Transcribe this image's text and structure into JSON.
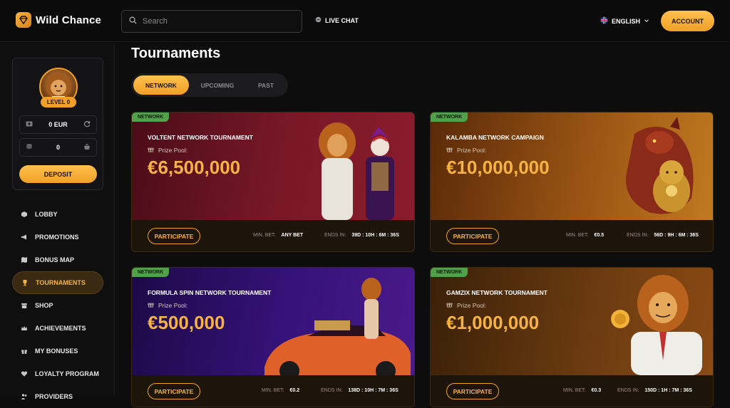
{
  "header": {
    "brand": "Wild Chance",
    "search_placeholder": "Search",
    "live_chat": "LIVE CHAT",
    "language": "ENGLISH",
    "account": "ACCOUNT"
  },
  "profile": {
    "level": "LEVEL 0",
    "balance": "0 EUR",
    "coins": "0",
    "deposit": "DEPOSIT"
  },
  "nav": [
    {
      "label": "LOBBY",
      "icon": "cube-icon"
    },
    {
      "label": "PROMOTIONS",
      "icon": "megaphone-icon"
    },
    {
      "label": "BONUS MAP",
      "icon": "map-icon"
    },
    {
      "label": "TOURNAMENTS",
      "icon": "trophy-icon",
      "active": true
    },
    {
      "label": "SHOP",
      "icon": "shop-icon"
    },
    {
      "label": "ACHIEVEMENTS",
      "icon": "crown-icon"
    },
    {
      "label": "MY BONUSES",
      "icon": "gift-icon"
    },
    {
      "label": "LOYALTY PROGRAM",
      "icon": "heart-icon"
    },
    {
      "label": "PROVIDERS",
      "icon": "people-icon"
    }
  ],
  "page": {
    "title": "Tournaments",
    "tabs": [
      "NETWORK",
      "UPCOMING",
      "PAST"
    ]
  },
  "cards": [
    {
      "badge": "NETWORK",
      "name": "VOLTENT NETWORK TOURNAMENT",
      "pool_label": "Prize Pool:",
      "pool": "€6,500,000",
      "participate": "PARTICIPATE",
      "min_bet_label": "MIN. BET:",
      "min_bet": "ANY BET",
      "ends_label": "ENDS IN:",
      "ends": "39D : 10H : 6M : 36S",
      "colors": {
        "from": "#5a0f1c",
        "to": "#8a1a2a"
      }
    },
    {
      "badge": "NETWORK",
      "name": "KALAMBA NETWORK CAMPAIGN",
      "pool_label": "Prize Pool:",
      "pool": "€10,000,000",
      "participate": "PARTICIPATE",
      "min_bet_label": "MIN. BET:",
      "min_bet": "€0.5",
      "ends_label": "ENDS IN:",
      "ends": "56D : 9H : 6M : 36S",
      "colors": {
        "from": "#6a320a",
        "to": "#b86a18"
      }
    },
    {
      "badge": "NETWORK",
      "name": "FORMULA SPIN NETWORK TOURNAMENT",
      "pool_label": "Prize Pool:",
      "pool": "€500,000",
      "participate": "PARTICIPATE",
      "min_bet_label": "MIN. BET:",
      "min_bet": "€0.2",
      "ends_label": "ENDS IN:",
      "ends": "138D : 10H : 7M : 36S",
      "colors": {
        "from": "#2a1060",
        "to": "#4a1a90"
      }
    },
    {
      "badge": "NETWORK",
      "name": "GAMZIX NETWORK TOURNAMENT",
      "pool_label": "Prize Pool:",
      "pool": "€1,000,000",
      "participate": "PARTICIPATE",
      "min_bet_label": "MIN. BET:",
      "min_bet": "€0.3",
      "ends_label": "ENDS IN:",
      "ends": "150D : 1H : 7M : 36S",
      "colors": {
        "from": "#4a2a0a",
        "to": "#8a4a12"
      }
    }
  ]
}
